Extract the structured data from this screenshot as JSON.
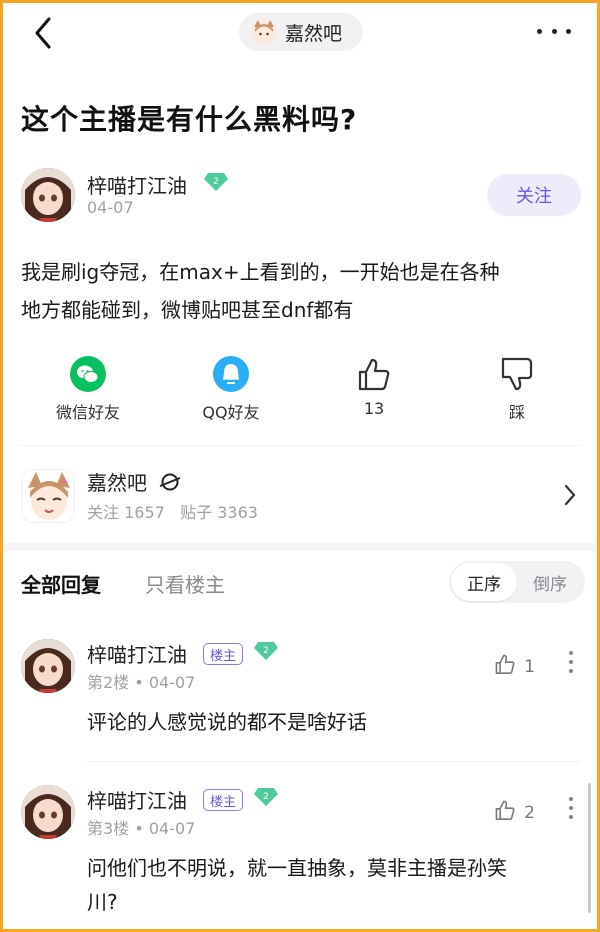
{
  "topbar": {
    "forum_name": "嘉然吧"
  },
  "post": {
    "title": "这个主播是有什么黑料吗?",
    "author": "梓喵打江油",
    "date": "04-07",
    "follow_label": "关注",
    "body_line1": "我是刷ig夺冠，在max+上看到的，一开始也是在各种",
    "body_line2": "地方都能碰到，微博贴吧甚至dnf都有"
  },
  "actions": {
    "wechat": "微信好友",
    "qq": "QQ好友",
    "like_count": "13",
    "dislike": "踩"
  },
  "forum_card": {
    "name": "嘉然吧",
    "follow_label": "关注",
    "follow_count": "1657",
    "posts_label": "贴子",
    "posts_count": "3363"
  },
  "tabs": {
    "all": "全部回复",
    "owner_only": "只看楼主",
    "sort_asc": "正序",
    "sort_desc": "倒序"
  },
  "replies": [
    {
      "name": "梓喵打江油",
      "badge": "楼主",
      "floor": "第2楼",
      "date": "04-07",
      "likes": "1",
      "text": "评论的人感觉说的都不是啥好话"
    },
    {
      "name": "梓喵打江油",
      "badge": "楼主",
      "floor": "第3楼",
      "date": "04-07",
      "likes": "2",
      "text_line1": "问他们也不明说，就一直抽象，莫非主播是孙笑",
      "text_line2": "川?"
    }
  ],
  "colors": {
    "accent": "#6a58d8",
    "follow_bg": "#eeebfb",
    "gem": "#4ecb9c",
    "wechat": "#07c160",
    "qq": "#2aaef5",
    "frame": "#f5a623"
  },
  "icons": [
    "back-icon",
    "more-icon",
    "gem-icon",
    "wechat-icon",
    "qq-icon",
    "thumbs-up-icon",
    "thumbs-down-icon",
    "chevron-right-icon",
    "planet-icon"
  ]
}
